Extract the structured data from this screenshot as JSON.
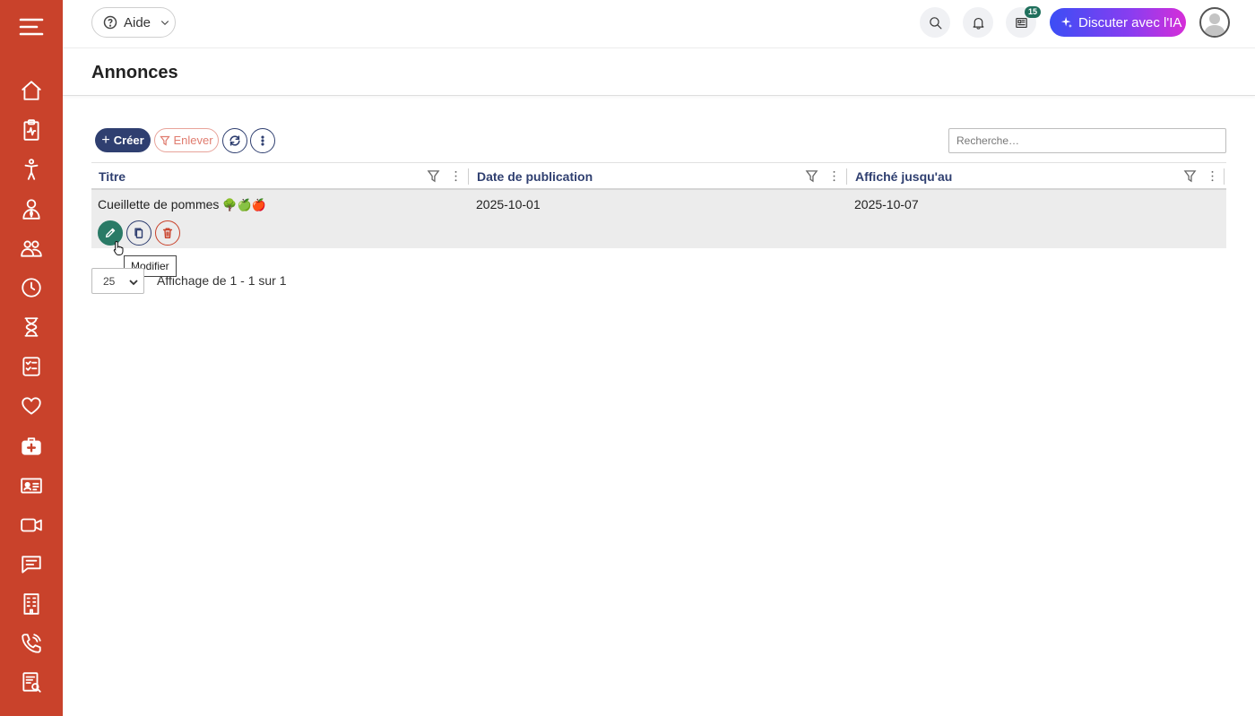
{
  "sidebar": {
    "items": [
      "hamburger-menu-icon",
      "home-icon",
      "clipboard-pulse-icon",
      "person-standing-icon",
      "user-tie-icon",
      "users-icon",
      "clock-icon",
      "hourglass-icon",
      "checklist-icon",
      "heart-icon",
      "medical-kit-icon",
      "id-card-icon",
      "video-camera-icon",
      "chat-icon",
      "building-icon",
      "phone-ring-icon",
      "report-search-icon"
    ]
  },
  "topbar": {
    "help_label": "Aide",
    "badge_count": "15",
    "ai_label": "Discuter avec l'IA"
  },
  "page": {
    "title": "Annonces"
  },
  "toolbar": {
    "create_label": "Créer",
    "remove_label": "Enlever",
    "search_placeholder": "Recherche…"
  },
  "table": {
    "columns": [
      "Titre",
      "Date de publication",
      "Affiché jusqu'au"
    ],
    "rows": [
      {
        "title": "Cueillette de pommes",
        "emojis": "🌳🍏🍎",
        "published": "2025-10-01",
        "until": "2025-10-07"
      }
    ]
  },
  "tooltip": {
    "text": "Modifier"
  },
  "pagination": {
    "page_size": "25",
    "info": "Affichage de 1 - 1 sur 1"
  },
  "colors": {
    "sidebar": "#c9422b",
    "primary": "#2f3f70",
    "edit": "#2a7a66",
    "danger": "#c9422b"
  }
}
